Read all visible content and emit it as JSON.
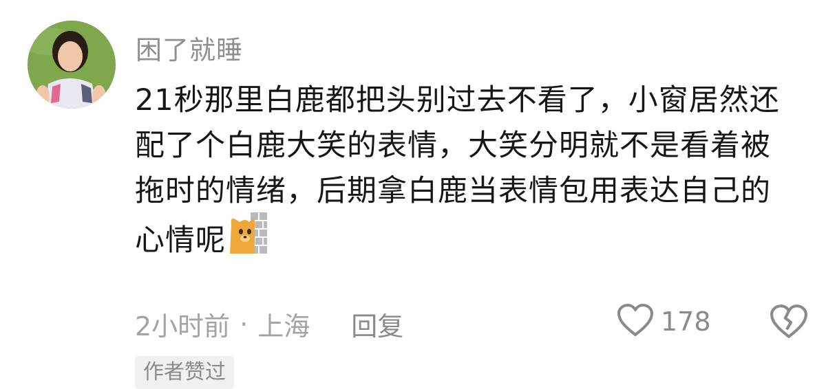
{
  "comment": {
    "username": "困了就睡",
    "text": "21秒那里白鹿都把头别过去不看了，小窗居然还配了个白鹿大笑的表情，大笑分明就不是看着被拖时的情绪，后期拿白鹿当表情包用表达自己的心情呢",
    "emoji": "cat-peeking-behind-wall-icon",
    "time": "2小时前",
    "separator": "·",
    "location": "上海",
    "reply_label": "回复",
    "like_count": "178",
    "badge": "作者赞过"
  }
}
